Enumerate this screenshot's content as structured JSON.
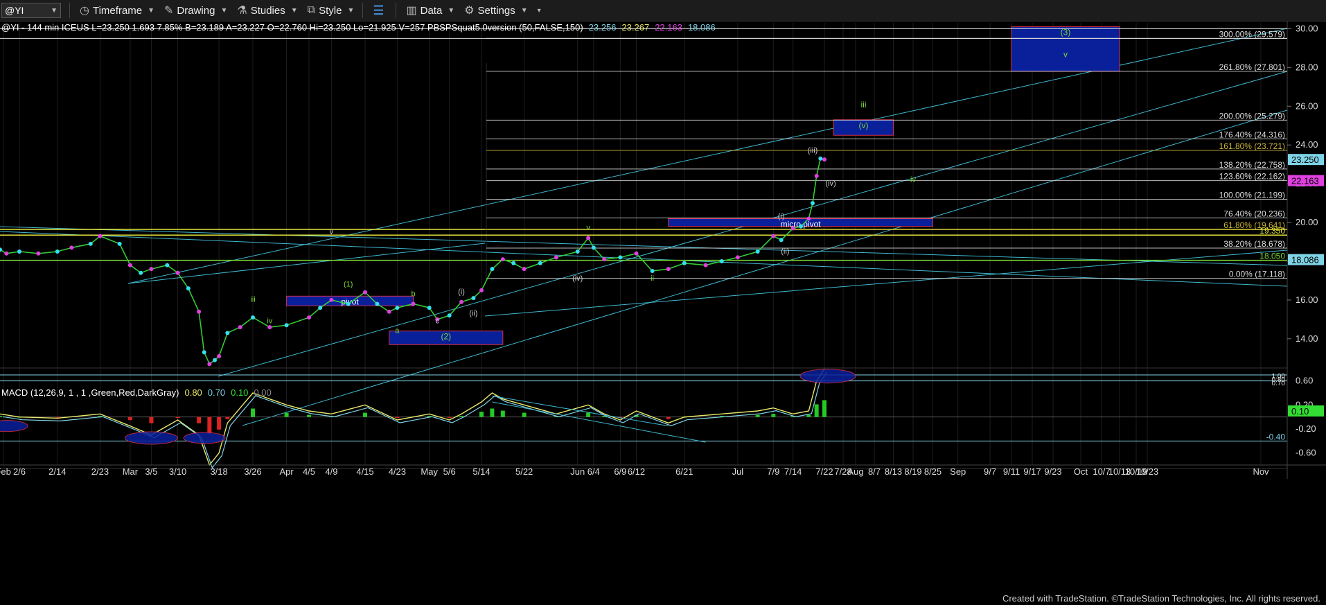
{
  "toolbar": {
    "symbol": "@YI",
    "timeframe": "Timeframe",
    "drawing": "Drawing",
    "studies": "Studies",
    "style": "Style",
    "data": "Data",
    "settings": "Settings"
  },
  "header": {
    "parts": [
      {
        "text": "@YI - 144 min  ICEUS  L=23.250  1.693  7.85%  B=23.189  A=23.227  O=22.760  Hi=23.250  Lo=21.925  V=257  PBSPSquat5.0version (50,FALSE,150)",
        "color": "#ffffff"
      },
      {
        "text": "23.256",
        "color": "#7fd3e6"
      },
      {
        "text": "23.267",
        "color": "#e8e86a"
      },
      {
        "text": "22.163",
        "color": "#e040e0"
      },
      {
        "text": "18.086",
        "color": "#7fd3e6"
      }
    ]
  },
  "macd_header": {
    "parts": [
      {
        "text": "MACD (12,26,9, 1 , 1 ,Green,Red,DarkGray)",
        "color": "#ffffff"
      },
      {
        "text": "0.80",
        "color": "#e8e86a"
      },
      {
        "text": "0.70",
        "color": "#7fd3e6"
      },
      {
        "text": "0.10",
        "color": "#33dd33"
      },
      {
        "text": "0.00",
        "color": "#888888"
      }
    ]
  },
  "chart_data": {
    "type": "line",
    "title": "@YI - 144 min",
    "price_axis": {
      "ticks": [
        "30.00",
        "28.00",
        "26.00",
        "24.00",
        "22.00",
        "20.00",
        "18.00",
        "16.00",
        "14.00"
      ],
      "tick_values": [
        30,
        28,
        26,
        24,
        22,
        20,
        18,
        16,
        14
      ],
      "ylim": [
        12.6,
        30.3
      ]
    },
    "macd_axis": {
      "ticks": [
        "0.60",
        "0.20",
        "-0.20",
        "-0.60"
      ],
      "tick_values": [
        0.6,
        0.2,
        -0.2,
        -0.6
      ]
    },
    "x_ticks": [
      "Feb",
      "2/6",
      "2/14",
      "2/23",
      "Mar",
      "3/5",
      "3/10",
      "3/18",
      "3/26",
      "Apr",
      "4/5",
      "4/9",
      "4/15",
      "4/23",
      "May",
      "5/6",
      "5/14",
      "5/22",
      "Jun",
      "6/4",
      "6/9",
      "6/12",
      "6/21",
      "Jul",
      "7/9",
      "7/14",
      "7/22",
      "7/28",
      "Aug",
      "8/7",
      "8/13",
      "8/19",
      "8/25",
      "Sep",
      "9/7",
      "9/11",
      "9/17",
      "9/23",
      "Oct",
      "10/7",
      "10/13",
      "10/19",
      "10/23",
      "Nov"
    ],
    "fib_levels": [
      {
        "label": "300.00% (29.579)",
        "value": 29.5,
        "color": "#dddddd"
      },
      {
        "label": "261.80% (27.801)",
        "value": 27.8,
        "color": "#dddddd"
      },
      {
        "label": "200.00% (25.279)",
        "value": 25.279,
        "color": "#dddddd"
      },
      {
        "label": "176.40% (24.316)",
        "value": 24.316,
        "color": "#dddddd"
      },
      {
        "label": "161.80% (23.721)",
        "value": 23.721,
        "color": "#c9b335"
      },
      {
        "label": "138.20% (22.758)",
        "value": 22.758,
        "color": "#dddddd"
      },
      {
        "label": "123.60% (22.162)",
        "value": 22.162,
        "color": "#dddddd"
      },
      {
        "label": "100.00% (21.199)",
        "value": 21.199,
        "color": "#dddddd"
      },
      {
        "label": "76.40% (20.236)",
        "value": 20.236,
        "color": "#dddddd"
      },
      {
        "label": "61.80% (19.641)",
        "value": 19.641,
        "color": "#c9b335"
      },
      {
        "label": "38.20% (18.678)",
        "value": 18.678,
        "color": "#dddddd"
      },
      {
        "label": "0.00% (17.118)",
        "value": 17.118,
        "color": "#dddddd"
      }
    ],
    "horizontal_lines": [
      {
        "label": "19.350",
        "value": 19.35,
        "color": "#e8e83a"
      },
      {
        "label": "18.050",
        "value": 18.05,
        "color": "#7ad835"
      }
    ],
    "price_badges": [
      {
        "label": "23.250",
        "value": 23.25,
        "bg": "#7fd3e6"
      },
      {
        "label": "22.163",
        "value": 22.163,
        "bg": "#e040e0"
      },
      {
        "label": "18.086",
        "value": 18.086,
        "bg": "#7fd3e6"
      }
    ],
    "macd_badges": [
      {
        "label": "0.10",
        "value": 0.1,
        "bg": "#33dd33"
      }
    ],
    "macd_top_labels": [
      "1.00",
      "0.80",
      "0.70"
    ],
    "series": [
      {
        "name": "price",
        "points": [
          [
            "1/31",
            18.6
          ],
          [
            "2/2",
            18.4
          ],
          [
            "2/6",
            18.5
          ],
          [
            "2/10",
            18.4
          ],
          [
            "2/14",
            18.5
          ],
          [
            "2/17",
            18.7
          ],
          [
            "2/21",
            18.9
          ],
          [
            "2/23",
            19.3
          ],
          [
            "2/27",
            18.9
          ],
          [
            "3/1",
            17.8
          ],
          [
            "3/3",
            17.4
          ],
          [
            "3/5",
            17.6
          ],
          [
            "3/8",
            17.8
          ],
          [
            "3/10",
            17.4
          ],
          [
            "3/12",
            16.6
          ],
          [
            "3/14",
            15.4
          ],
          [
            "3/15",
            13.3
          ],
          [
            "3/16",
            12.7
          ],
          [
            "3/17",
            12.9
          ],
          [
            "3/18",
            13.1
          ],
          [
            "3/20",
            14.3
          ],
          [
            "3/23",
            14.6
          ],
          [
            "3/26",
            15.1
          ],
          [
            "3/29",
            14.6
          ],
          [
            "4/1",
            14.7
          ],
          [
            "4/5",
            15.1
          ],
          [
            "4/7",
            15.6
          ],
          [
            "4/9",
            16.0
          ],
          [
            "4/12",
            15.8
          ],
          [
            "4/15",
            16.4
          ],
          [
            "4/18",
            15.8
          ],
          [
            "4/21",
            15.4
          ],
          [
            "4/23",
            15.6
          ],
          [
            "4/27",
            15.8
          ],
          [
            "5/1",
            15.6
          ],
          [
            "5/3",
            15.0
          ],
          [
            "5/6",
            15.2
          ],
          [
            "5/9",
            15.9
          ],
          [
            "5/12",
            16.1
          ],
          [
            "5/14",
            16.5
          ],
          [
            "5/16",
            17.6
          ],
          [
            "5/18",
            18.1
          ],
          [
            "5/20",
            17.9
          ],
          [
            "5/22",
            17.6
          ],
          [
            "5/25",
            17.9
          ],
          [
            "5/28",
            18.2
          ],
          [
            "6/1",
            18.5
          ],
          [
            "6/3",
            19.2
          ],
          [
            "6/4",
            18.7
          ],
          [
            "6/6",
            18.1
          ],
          [
            "6/9",
            18.2
          ],
          [
            "6/12",
            18.4
          ],
          [
            "6/15",
            17.5
          ],
          [
            "6/18",
            17.6
          ],
          [
            "6/21",
            17.9
          ],
          [
            "6/25",
            17.8
          ],
          [
            "6/28",
            18.0
          ],
          [
            "7/1",
            18.2
          ],
          [
            "7/5",
            18.5
          ],
          [
            "7/9",
            19.3
          ],
          [
            "7/11",
            19.1
          ],
          [
            "7/14",
            19.7
          ],
          [
            "7/16",
            19.8
          ],
          [
            "7/18",
            20.2
          ],
          [
            "7/19",
            21.0
          ],
          [
            "7/20",
            22.4
          ],
          [
            "7/21",
            23.3
          ],
          [
            "7/22",
            23.25
          ]
        ]
      },
      {
        "name": "MACD",
        "points": [
          [
            "1/31",
            0.05
          ],
          [
            "2/6",
            0.0
          ],
          [
            "2/14",
            -0.02
          ],
          [
            "2/23",
            0.05
          ],
          [
            "3/1",
            -0.15
          ],
          [
            "3/5",
            -0.3
          ],
          [
            "3/10",
            -0.05
          ],
          [
            "3/14",
            -0.3
          ],
          [
            "3/16",
            -0.8
          ],
          [
            "3/18",
            -0.6
          ],
          [
            "3/20",
            -0.1
          ],
          [
            "3/26",
            0.4
          ],
          [
            "4/1",
            0.2
          ],
          [
            "4/5",
            0.1
          ],
          [
            "4/9",
            0.05
          ],
          [
            "4/15",
            0.2
          ],
          [
            "4/23",
            -0.05
          ],
          [
            "5/1",
            0.05
          ],
          [
            "5/6",
            -0.05
          ],
          [
            "5/9",
            0.05
          ],
          [
            "5/14",
            0.25
          ],
          [
            "5/16",
            0.4
          ],
          [
            "5/18",
            0.3
          ],
          [
            "5/22",
            0.2
          ],
          [
            "5/28",
            0.05
          ],
          [
            "6/3",
            0.2
          ],
          [
            "6/6",
            0.05
          ],
          [
            "6/9",
            -0.05
          ],
          [
            "6/12",
            0.1
          ],
          [
            "6/18",
            -0.1
          ],
          [
            "6/21",
            0.0
          ],
          [
            "6/28",
            0.05
          ],
          [
            "7/5",
            0.1
          ],
          [
            "7/9",
            0.15
          ],
          [
            "7/14",
            0.05
          ],
          [
            "7/18",
            0.1
          ],
          [
            "7/20",
            0.6
          ],
          [
            "7/22",
            0.8
          ]
        ]
      }
    ],
    "target_boxes": [
      {
        "label": "(3)",
        "sub": "v",
        "x0": "9/11",
        "x1": "10/13",
        "y0": 27.8,
        "y1": 30.1
      },
      {
        "label": "(v)",
        "sub": "iii",
        "x0": "7/25",
        "x1": "8/13",
        "y0": 24.5,
        "y1": 25.3
      },
      {
        "label": "micro pivot",
        "x0": "6/18",
        "x1": "8/25",
        "y0": 19.8,
        "y1": 20.2
      },
      {
        "label": "(2)",
        "x0": "4/21",
        "x1": "5/18",
        "y0": 13.7,
        "y1": 14.4
      },
      {
        "label": "pivot",
        "x0": "4/1",
        "x1": "4/27",
        "y0": 15.7,
        "y1": 16.2
      }
    ],
    "wave_labels": [
      {
        "text": "(1)",
        "x": "4/12",
        "y": 16.7,
        "color": "#7ad835"
      },
      {
        "text": "iii",
        "x": "3/26",
        "y": 15.9,
        "color": "#7ad835"
      },
      {
        "text": "iv",
        "x": "3/29",
        "y": 14.8,
        "color": "#7ad835"
      },
      {
        "text": "b",
        "x": "4/27",
        "y": 16.2,
        "color": "#7ad835"
      },
      {
        "text": "a",
        "x": "4/23",
        "y": 14.3,
        "color": "#7ad835"
      },
      {
        "text": "c",
        "x": "5/3",
        "y": 14.8,
        "color": "#cccccc"
      },
      {
        "text": "(i)",
        "x": "5/9",
        "y": 16.3,
        "color": "#cccccc"
      },
      {
        "text": "(ii)",
        "x": "5/12",
        "y": 15.2,
        "color": "#cccccc"
      },
      {
        "text": "(iv)",
        "x": "6/1",
        "y": 17.0,
        "color": "#cccccc"
      },
      {
        "text": "ii",
        "x": "6/15",
        "y": 17.0,
        "color": "#7ad835"
      },
      {
        "text": "(i)",
        "x": "7/11",
        "y": 20.2,
        "color": "#cccccc"
      },
      {
        "text": "(ii)",
        "x": "7/12",
        "y": 18.4,
        "color": "#cccccc"
      },
      {
        "text": "(iii)",
        "x": "7/19",
        "y": 23.6,
        "color": "#cccccc"
      },
      {
        "text": "(iv)",
        "x": "7/24",
        "y": 21.9,
        "color": "#cccccc"
      },
      {
        "text": "iv",
        "x": "8/19",
        "y": 22.1,
        "color": "#7ad835"
      },
      {
        "text": "v",
        "x": "4/9",
        "y": 19.4,
        "color": "#cccccc"
      },
      {
        "text": "v",
        "x": "6/3",
        "y": 19.6,
        "color": "#7ad835"
      }
    ]
  },
  "footer": "Created with TradeStation. ©TradeStation Technologies, Inc. All rights reserved."
}
